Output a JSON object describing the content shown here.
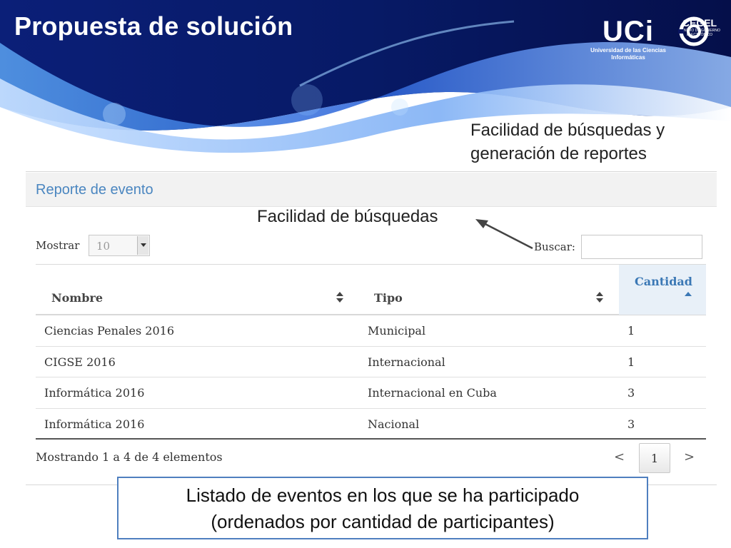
{
  "slide": {
    "title": "Propuesta de solución",
    "note_top_line1": "Facilidad de búsquedas y",
    "note_top_line2": "generación de reportes",
    "note_search": "Facilidad de búsquedas",
    "caption_line1": "Listado de eventos en los que se ha participado",
    "caption_line2": "(ordenados por cantidad de participantes)"
  },
  "logos": {
    "uci_mark": "UCi",
    "uci_line1": "Universidad de las Ciencias",
    "uci_line2": "Informáticas",
    "cegel_mark": "CEGEL",
    "cegel_line1": "CENTRO DE GOBIERNO",
    "cegel_line2": "ELECTRÓNICO"
  },
  "panel": {
    "heading": "Reporte de evento",
    "show_label": "Mostrar",
    "page_size": "10",
    "search_label": "Buscar:",
    "search_value": ""
  },
  "table": {
    "columns": [
      "Nombre",
      "Tipo",
      "Cantidad"
    ],
    "sorted_column": "Cantidad",
    "rows": [
      {
        "nombre": "Ciencias Penales 2016",
        "tipo": "Municipal",
        "cantidad": "1"
      },
      {
        "nombre": "CIGSE 2016",
        "tipo": "Internacional",
        "cantidad": "1"
      },
      {
        "nombre": "Informática 2016",
        "tipo": "Internacional en Cuba",
        "cantidad": "3"
      },
      {
        "nombre": "Informática 2016",
        "tipo": "Nacional",
        "cantidad": "3"
      }
    ]
  },
  "footer": {
    "info": "Mostrando 1 a 4 de 4 elementos",
    "prev": "<",
    "page": "1",
    "next": ">"
  },
  "colors": {
    "banner_dark": "#0a1a6e",
    "banner_mid": "#1f4fb8",
    "heading_text": "#4a86c0",
    "caption_border": "#4f7fbf"
  }
}
